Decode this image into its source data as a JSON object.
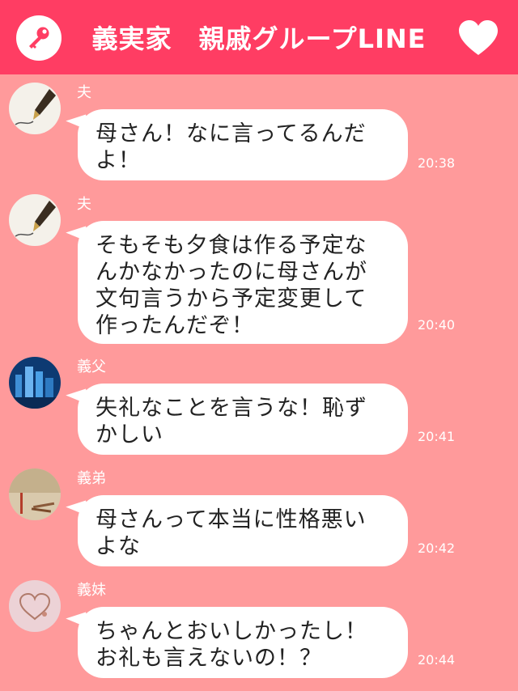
{
  "header": {
    "title": "義実家　親戚グループLINE",
    "left_icon": "key-icon",
    "right_icon": "heart-icon"
  },
  "colors": {
    "header_bg": "#ff3d63",
    "chat_bg": "#ff9a9b",
    "bubble_bg": "#ffffff"
  },
  "messages": [
    {
      "sender": "夫",
      "avatar": "fountain-pen-avatar",
      "text": "母さん！なに言ってるんだ\nよ！",
      "time": "20:38"
    },
    {
      "sender": "夫",
      "avatar": "fountain-pen-avatar",
      "text": "そもそも夕食は作る予定な\nんかなかったのに母さんが\n文句言うから予定変更して\n作ったんだぞ！",
      "time": "20:40"
    },
    {
      "sender": "義父",
      "avatar": "city-night-avatar",
      "text": "失礼なことを言うな！恥ず\nかしい",
      "time": "20:41"
    },
    {
      "sender": "義弟",
      "avatar": "matches-avatar",
      "text": "母さんって本当に性格悪い\nよな",
      "time": "20:42"
    },
    {
      "sender": "義妹",
      "avatar": "necklace-heart-avatar",
      "text": "ちゃんとおいしかったし！\nお礼も言えないの！？",
      "time": "20:44"
    }
  ]
}
